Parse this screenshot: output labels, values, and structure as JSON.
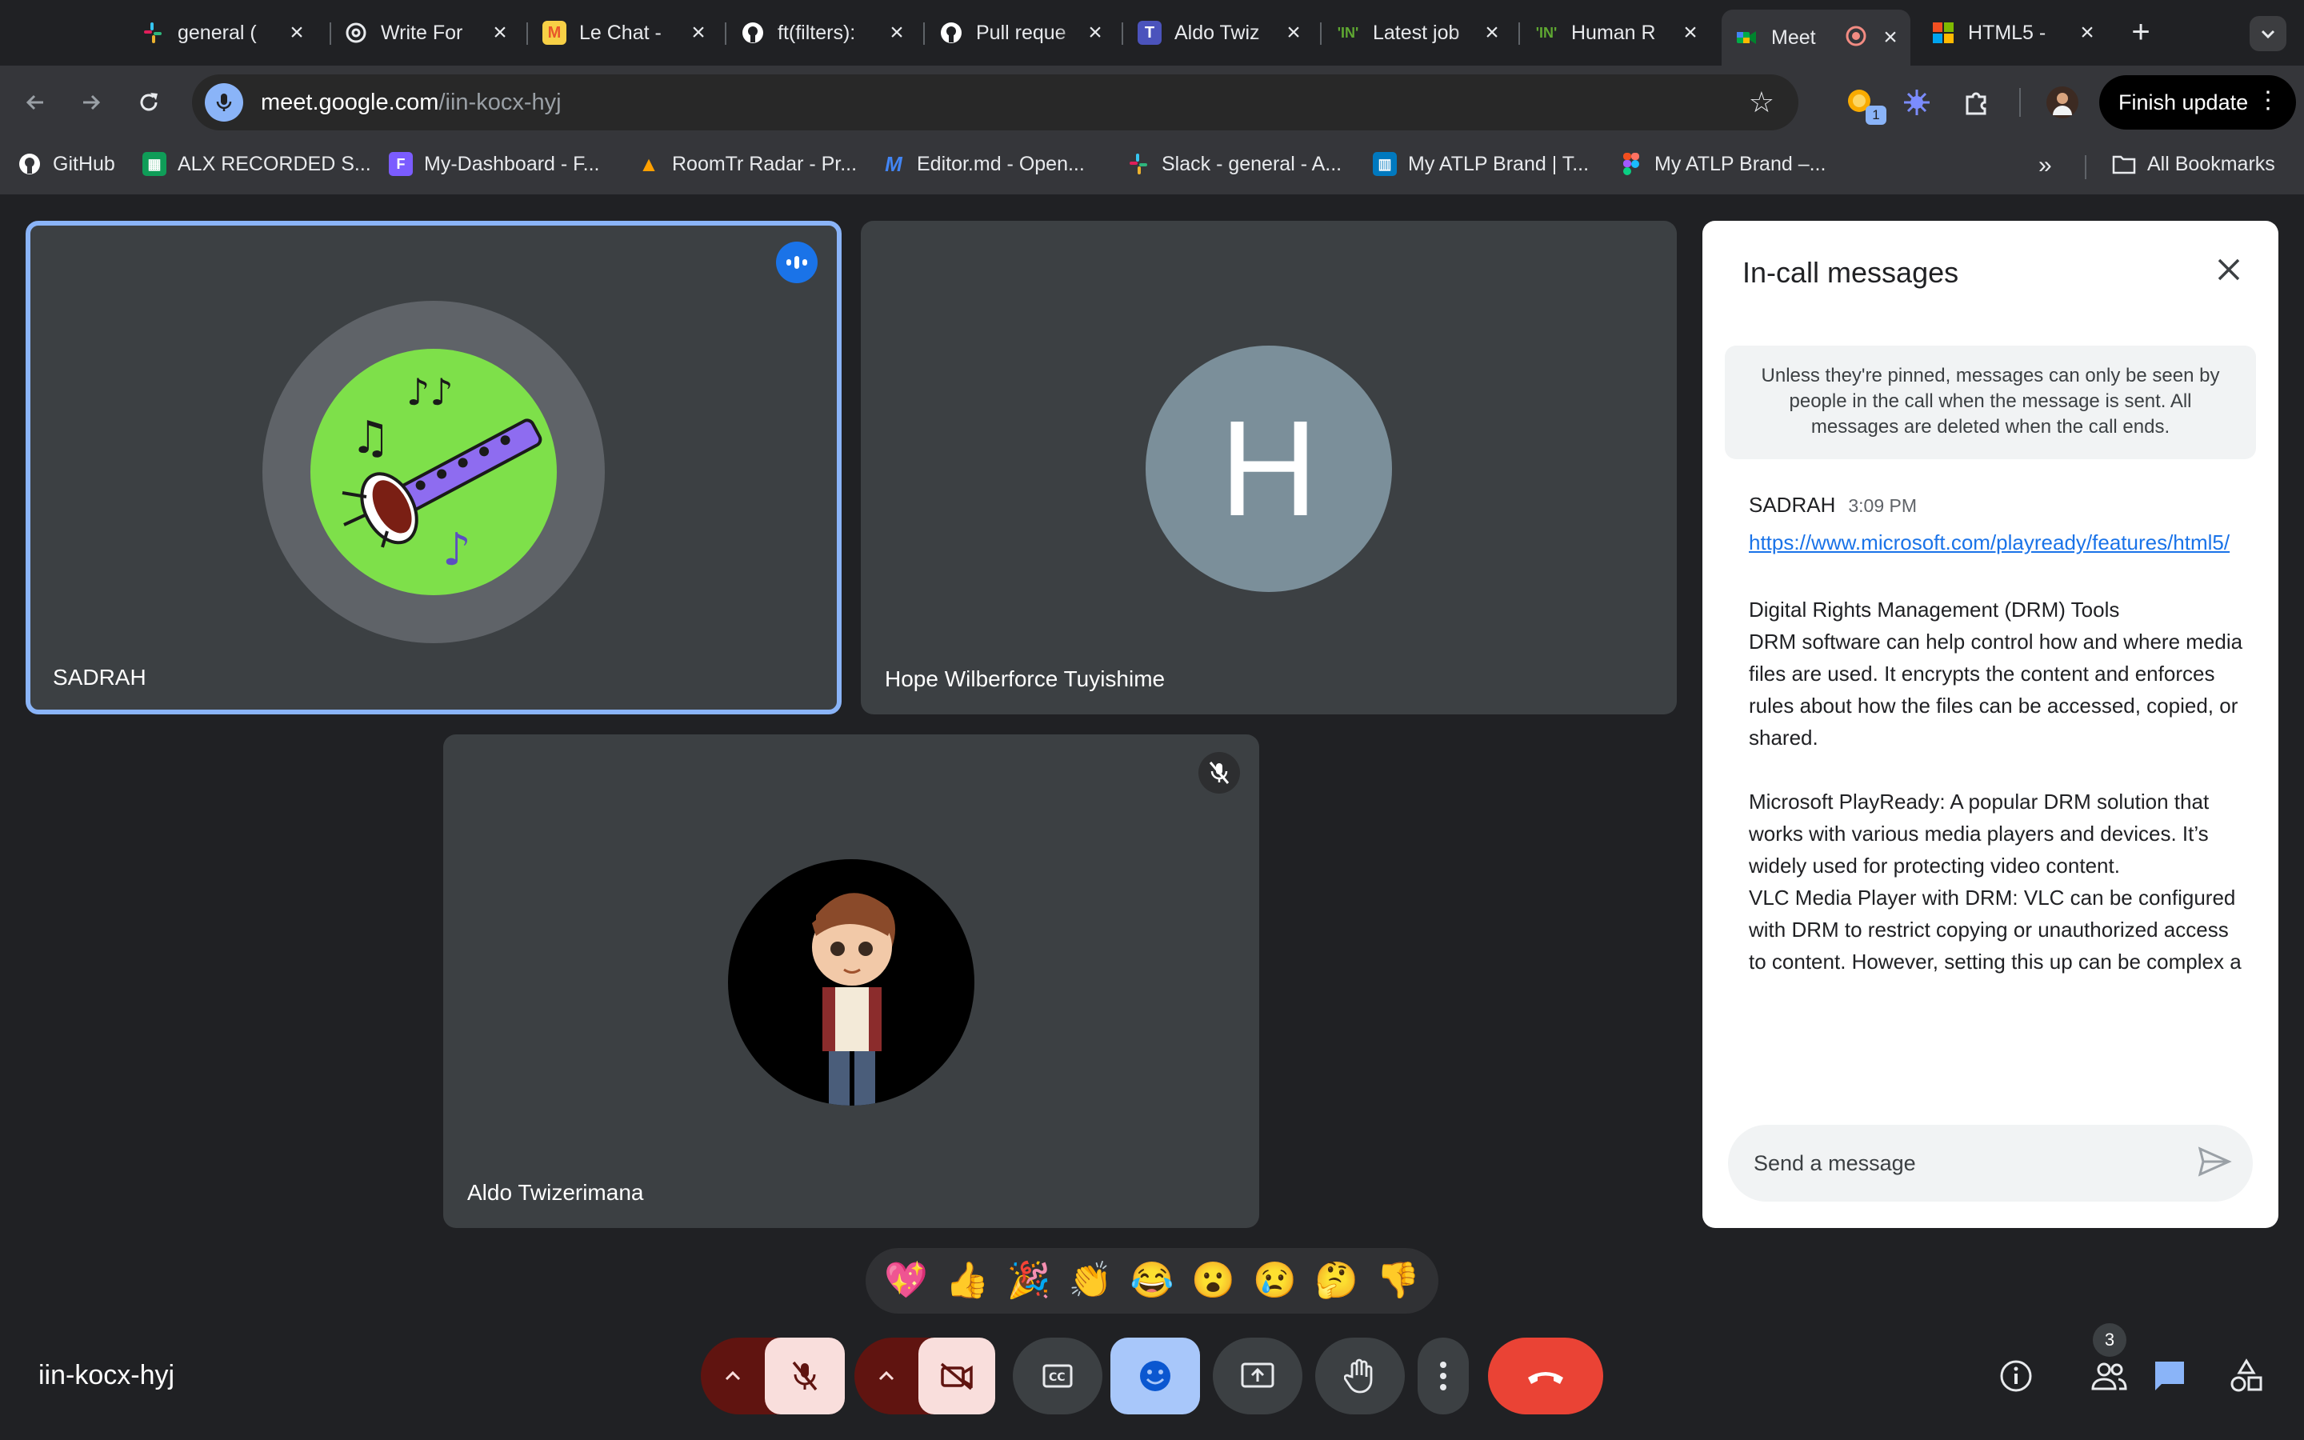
{
  "browser": {
    "tabs": [
      {
        "title": "general (",
        "icon": "slack-icon"
      },
      {
        "title": "Write For",
        "icon": "openai-icon"
      },
      {
        "title": "Le Chat -",
        "icon": "mistral-icon"
      },
      {
        "title": "ft(filters):",
        "icon": "github-icon"
      },
      {
        "title": "Pull reque",
        "icon": "github-icon"
      },
      {
        "title": "Aldo Twiz",
        "icon": "teams-icon"
      },
      {
        "title": "Latest job",
        "icon": "indeed-icon"
      },
      {
        "title": "Human R",
        "icon": "indeed-icon"
      },
      {
        "title": "Meet",
        "icon": "meet-icon",
        "active": true
      },
      {
        "title": "HTML5 -",
        "icon": "microsoft-icon"
      }
    ],
    "new_tab_label": "+",
    "url_host": "meet.google.com",
    "url_path": "/iin-kocx-hyj",
    "extension_badge": "1",
    "finish_update_label": "Finish update",
    "bookmarks": [
      {
        "label": "GitHub",
        "icon": "github-icon"
      },
      {
        "label": "ALX RECORDED S...",
        "icon": "sheets-icon"
      },
      {
        "label": "My-Dashboard - F...",
        "icon": "figma-purple-icon"
      },
      {
        "label": "RoomTr Radar - Pr...",
        "icon": "firebase-icon"
      },
      {
        "label": "Editor.md - Open...",
        "icon": "editor-icon"
      },
      {
        "label": "Slack - general - A...",
        "icon": "slack-icon"
      },
      {
        "label": "My ATLP Brand | T...",
        "icon": "trello-icon"
      },
      {
        "label": "My ATLP Brand –...",
        "icon": "figma-icon"
      }
    ],
    "more_bookmarks_label": "»",
    "all_bookmarks_label": "All Bookmarks"
  },
  "participants": [
    {
      "name": "SADRAH",
      "speaking": true,
      "avatar": "clarinet-music-icon"
    },
    {
      "name": "Hope Wilberforce Tuyishime",
      "initial": "H",
      "avatar_color": "#7b8f9a"
    },
    {
      "name": "Aldo Twizerimana",
      "muted": true,
      "avatar": "cartoon-boy-avatar"
    }
  ],
  "chat": {
    "title": "In-call messages",
    "notice": "Unless they're pinned, messages can only be seen by people in the call when the message is sent. All messages are deleted when the call ends.",
    "messages": [
      {
        "sender": "SADRAH",
        "time": "3:09 PM",
        "link": "https://www.microsoft.com/playready/features/html5/",
        "body": "Digital Rights Management (DRM) Tools\nDRM software can help control how and where media files are used. It encrypts the content and enforces rules about how the files can be accessed, copied, or shared.\n\nMicrosoft PlayReady: A popular DRM solution that works with various media players and devices. It’s widely used for protecting video content.\nVLC Media Player with DRM: VLC can be configured with DRM to restrict copying or unauthorized access to content. However, setting this up can be complex a"
      }
    ],
    "input_placeholder": "Send a message"
  },
  "reactions": [
    "💖",
    "👍",
    "🎉",
    "👏",
    "😂",
    "😮",
    "😢",
    "🤔",
    "👎"
  ],
  "meeting_code": "iin-kocx-hyj",
  "people_count": "3",
  "colors": {
    "accent": "#8ab4f8",
    "end_call": "#ea4335",
    "mute_bg": "#f9dedc",
    "mute_fg": "#601410",
    "speaking_border": "#8ab4f8"
  }
}
